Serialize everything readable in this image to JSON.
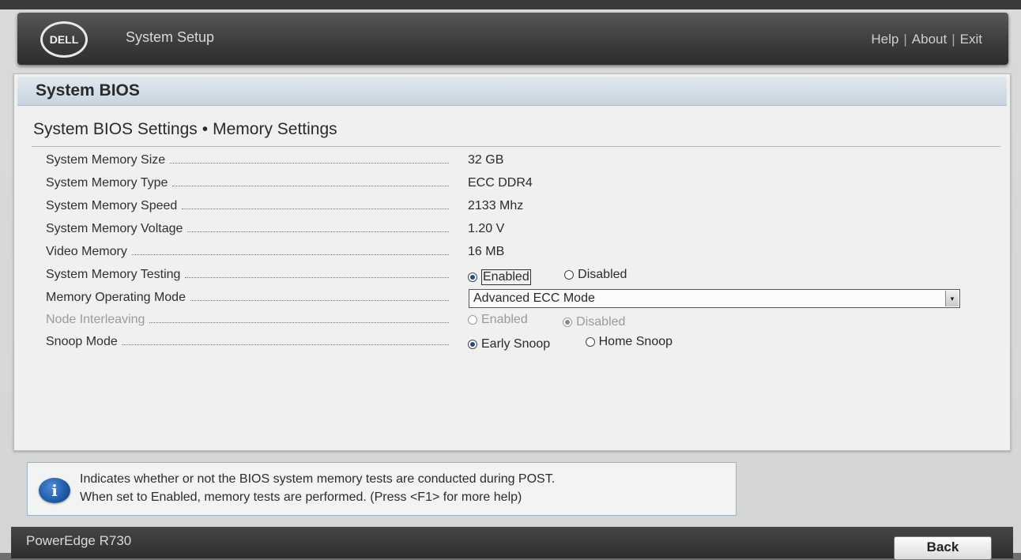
{
  "header": {
    "logo_text": "DELL",
    "app_title": "System Setup",
    "links": [
      "Help",
      "About",
      "Exit"
    ],
    "separator": "|"
  },
  "panel": {
    "title": "System BIOS",
    "breadcrumb": [
      "System BIOS Settings",
      "Memory Settings"
    ],
    "breadcrumb_separator": "•"
  },
  "settings": {
    "memory_size": {
      "label": "System Memory Size",
      "value": "32 GB"
    },
    "memory_type": {
      "label": "System Memory Type",
      "value": "ECC DDR4"
    },
    "memory_speed": {
      "label": "System Memory Speed",
      "value": "2133 Mhz"
    },
    "memory_voltage": {
      "label": "System Memory Voltage",
      "value": "1.20 V"
    },
    "video_memory": {
      "label": "Video Memory",
      "value": "16 MB"
    },
    "memory_testing": {
      "label": "System Memory Testing",
      "options": [
        "Enabled",
        "Disabled"
      ],
      "selected": "Enabled"
    },
    "operating_mode": {
      "label": "Memory Operating Mode",
      "selected": "Advanced ECC Mode"
    },
    "node_interleaving": {
      "label": "Node Interleaving",
      "options": [
        "Enabled",
        "Disabled"
      ],
      "selected": "Disabled",
      "disabled": true
    },
    "snoop_mode": {
      "label": "Snoop Mode",
      "options": [
        "Early Snoop",
        "Home Snoop"
      ],
      "selected": "Early Snoop"
    }
  },
  "help": {
    "icon": "info-icon",
    "line1": "Indicates whether or not the BIOS system memory tests are conducted during POST.",
    "line2": "When set to Enabled, memory tests are performed. (Press <F1> for more help)"
  },
  "footer": {
    "model": "PowerEdge R730",
    "back_label": "Back"
  },
  "colors": {
    "header_bg": "#3f3d3c",
    "title_bar": "#c7d4df",
    "radio_selected": "#1f4a8a",
    "info_icon": "#1e5aa8"
  }
}
